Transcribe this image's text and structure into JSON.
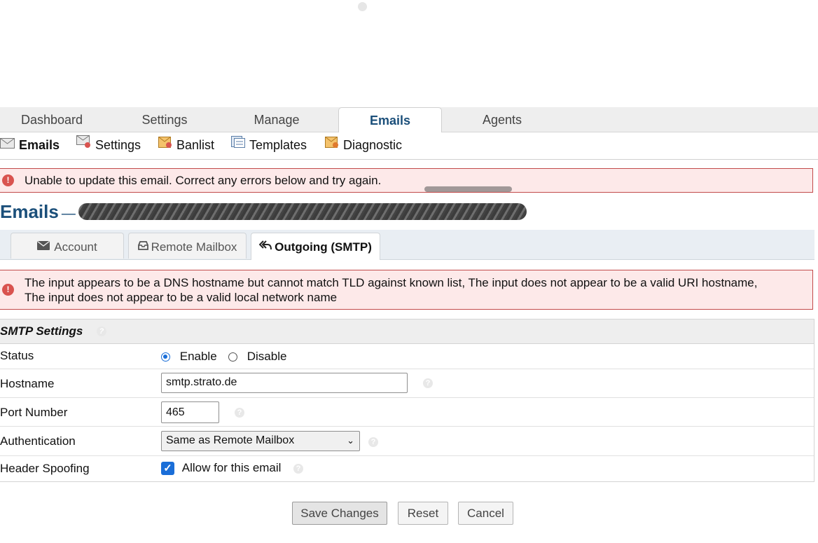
{
  "top_nav": [
    "Dashboard",
    "Settings",
    "Manage",
    "Emails",
    "Agents"
  ],
  "sub_nav": [
    "Emails",
    "Settings",
    "Banlist",
    "Templates",
    "Diagnostic"
  ],
  "alert_top": "Unable to update this email. Correct any errors below and try again.",
  "heading": {
    "title": "Emails",
    "separator": "—"
  },
  "content_tabs": [
    "Account",
    "Remote Mailbox",
    "Outgoing (SMTP)"
  ],
  "alert_error": {
    "line1": "The input appears to be a DNS hostname but cannot match TLD against known list, The input does not appear to be a valid URI hostname,",
    "line2": "The input does not appear to be a valid local network name"
  },
  "smtp": {
    "section_title": "SMTP Settings",
    "status_label": "Status",
    "status_enable": "Enable",
    "status_disable": "Disable",
    "status_selected": "Enable",
    "hostname_label": "Hostname",
    "hostname_value": "smtp.strato.de",
    "port_label": "Port Number",
    "port_value": "465",
    "auth_label": "Authentication",
    "auth_value": "Same as Remote Mailbox",
    "spoof_label": "Header Spoofing",
    "spoof_option": "Allow for this email",
    "spoof_checked": true
  },
  "buttons": {
    "save": "Save Changes",
    "reset": "Reset",
    "cancel": "Cancel"
  },
  "colors": {
    "accent": "#1b4f7a",
    "error_bg": "#fde9e9",
    "error_border": "#c24a4a",
    "control_blue": "#1a6ed8"
  }
}
